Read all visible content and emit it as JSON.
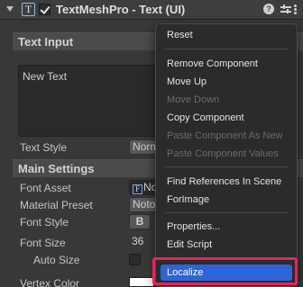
{
  "component": {
    "title": "TextMeshPro - Text (UI)",
    "icon_letter": "T",
    "enabled": true,
    "help_glyph": "?"
  },
  "inspector": {
    "text_input_header": "Text Input",
    "text_value": "New Text",
    "text_style_label": "Text Style",
    "text_style_value": "Norm",
    "main_settings_header": "Main Settings",
    "font_asset_label": "Font Asset",
    "font_asset_value": "No",
    "font_asset_icon_letter": "F",
    "material_preset_label": "Material Preset",
    "material_preset_value": "Noto",
    "font_style_label": "Font Style",
    "font_style_bold": "B",
    "font_size_label": "Font Size",
    "font_size_value": "36",
    "auto_size_label": "Auto Size",
    "vertex_color_label": "Vertex Color"
  },
  "context_menu": {
    "items": [
      {
        "label": "Reset",
        "enabled": true
      },
      {
        "label": "Remove Component",
        "enabled": true
      },
      {
        "label": "Move Up",
        "enabled": true
      },
      {
        "label": "Move Down",
        "enabled": false
      },
      {
        "label": "Copy Component",
        "enabled": true
      },
      {
        "label": "Paste Component As New",
        "enabled": false
      },
      {
        "label": "Paste Component Values",
        "enabled": false
      },
      {
        "label": "Find References In Scene",
        "enabled": true
      },
      {
        "label": "ForImage",
        "enabled": true
      },
      {
        "label": "Properties...",
        "enabled": true
      },
      {
        "label": "Edit Script",
        "enabled": true
      },
      {
        "label": "Localize",
        "enabled": true,
        "selected": true
      }
    ]
  },
  "colors": {
    "selection": "#2d64d8",
    "highlight_outline": "#e8245a"
  }
}
